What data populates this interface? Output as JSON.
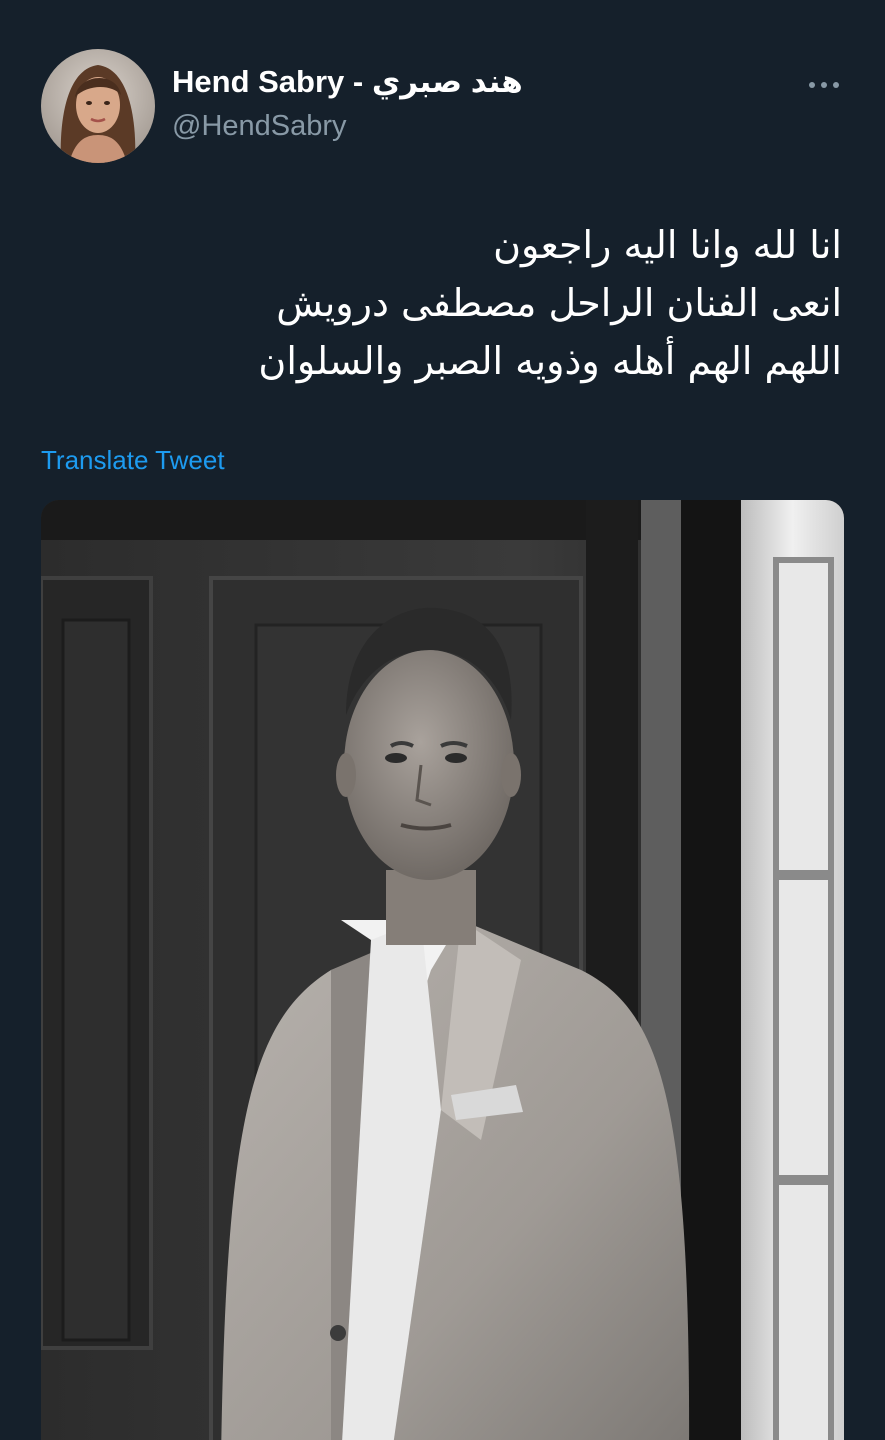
{
  "author": {
    "display_name": "Hend Sabry - هند صبري",
    "handle": "@HendSabry",
    "avatar_icon": "profile-photo"
  },
  "more_icon": "more-horizontal-icon",
  "tweet": {
    "lines": [
      "انا لله وانا اليه راجعون",
      "انعى الفنان الراحل مصطفى درويش",
      "اللهم الهم أهله وذويه الصبر والسلوان"
    ]
  },
  "translate_label": "Translate Tweet",
  "media": {
    "kind": "black-and-white portrait photo"
  },
  "colors": {
    "background": "#15202b",
    "secondary_text": "#8899a6",
    "link": "#1d9bf0"
  }
}
